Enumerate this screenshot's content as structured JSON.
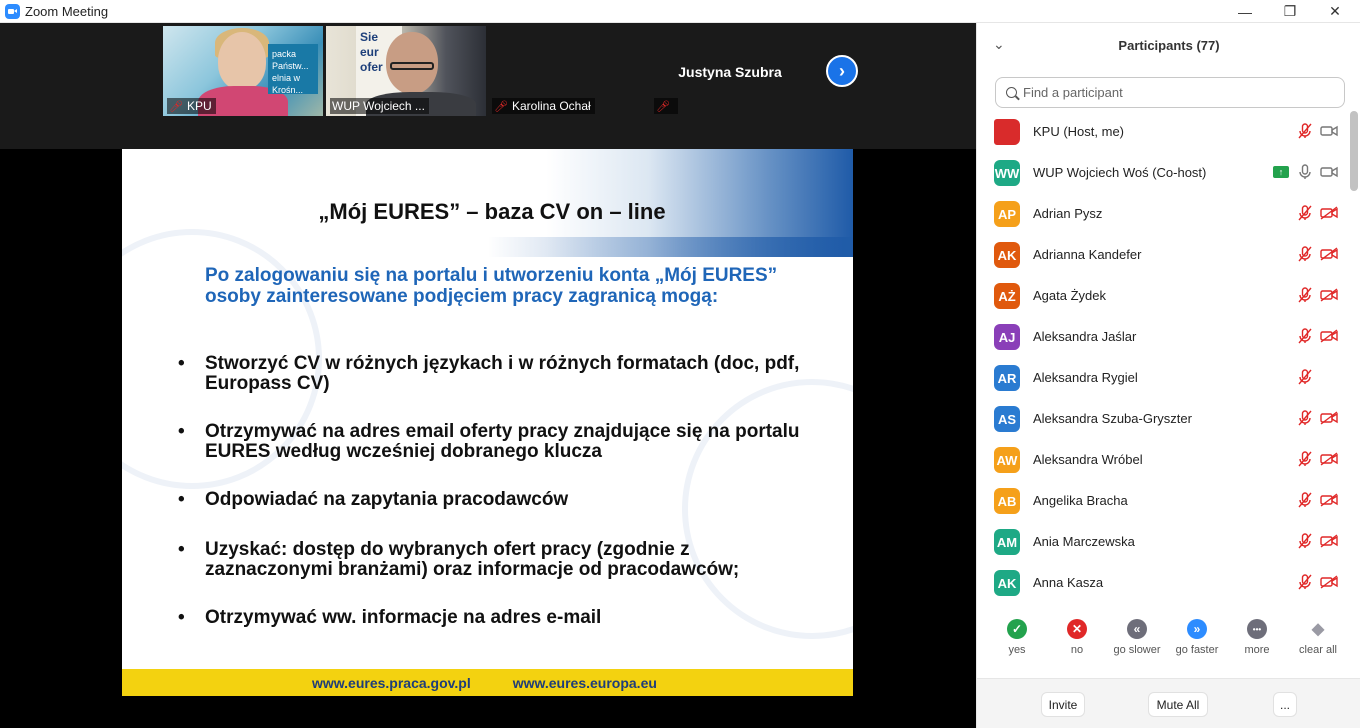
{
  "window": {
    "title": "Zoom Meeting"
  },
  "video_strip": {
    "tiles": [
      {
        "name": "KPU",
        "muted": true
      },
      {
        "name": "WUP Wojciech ...",
        "muted": false
      },
      {
        "name": "Karolina Ochał",
        "muted": true
      },
      {
        "name": "Justyna Szubra",
        "muted": true
      }
    ],
    "thumb1_sign": "packa Państw... elnia w Krośn...",
    "thumb2_sign": "Sie eur ofer"
  },
  "slide": {
    "title": "„Mój EURES” – baza CV on – line",
    "intro": "Po zalogowaniu się na portalu i utworzeniu konta „Mój EURES” osoby zainteresowane podjęciem pracy zagranicą mogą:",
    "bullet_symbol": "•",
    "bullets": [
      "Stworzyć CV w różnych językach i w różnych formatach (doc, pdf, Europass CV)",
      "Otrzymywać na adres email oferty pracy znajdujące się na portalu EURES według wcześniej dobranego klucza",
      "Odpowiadać na zapytania pracodawców",
      "Uzyskać: dostęp do wybranych ofert pracy (zgodnie z zaznaczonymi branżami) oraz informacje od pracodawców;",
      "Otrzymywać ww. informacje na adres e-mail"
    ],
    "footer_links": [
      "www.eures.praca.gov.pl",
      "www.eures.europa.eu"
    ]
  },
  "participants_panel": {
    "title": "Participants (77)",
    "search_placeholder": "Find a participant",
    "participants": [
      {
        "name": "KPU (Host, me)",
        "initials": "",
        "avatar_color": "#d92b2b",
        "mic": "muted",
        "cam": "on",
        "sharing": false
      },
      {
        "name": "WUP Wojciech Woś (Co-host)",
        "initials": "WW",
        "avatar_color": "#1ea985",
        "mic": "on",
        "cam": "on",
        "sharing": true
      },
      {
        "name": "Adrian Pysz",
        "initials": "AP",
        "avatar_color": "#f5a01a",
        "mic": "muted",
        "cam": "off",
        "sharing": false
      },
      {
        "name": "Adrianna Kandefer",
        "initials": "AK",
        "avatar_color": "#e0590d",
        "mic": "muted",
        "cam": "off",
        "sharing": false
      },
      {
        "name": "Agata Żydek",
        "initials": "AŻ",
        "avatar_color": "#e0590d",
        "mic": "muted",
        "cam": "off",
        "sharing": false
      },
      {
        "name": "Aleksandra Jaślar",
        "initials": "AJ",
        "avatar_color": "#8a3fb8",
        "mic": "muted",
        "cam": "off",
        "sharing": false
      },
      {
        "name": "Aleksandra Rygiel",
        "initials": "AR",
        "avatar_color": "#2a7bd1",
        "mic": "muted",
        "cam": "none",
        "sharing": false
      },
      {
        "name": "Aleksandra Szuba-Gryszter",
        "initials": "AS",
        "avatar_color": "#2a7bd1",
        "mic": "muted",
        "cam": "off",
        "sharing": false
      },
      {
        "name": "Aleksandra Wróbel",
        "initials": "AW",
        "avatar_color": "#f5a01a",
        "mic": "muted",
        "cam": "off",
        "sharing": false
      },
      {
        "name": "Angelika Bracha",
        "initials": "AB",
        "avatar_color": "#f5a01a",
        "mic": "muted",
        "cam": "off",
        "sharing": false
      },
      {
        "name": "Ania Marczewska",
        "initials": "AM",
        "avatar_color": "#1ea985",
        "mic": "muted",
        "cam": "off",
        "sharing": false
      },
      {
        "name": "Anna Kasza",
        "initials": "AK",
        "avatar_color": "#1ea985",
        "mic": "muted",
        "cam": "off",
        "sharing": false
      }
    ],
    "reactions": [
      {
        "label": "yes",
        "glyph": "✓",
        "color": "#23a24d"
      },
      {
        "label": "no",
        "glyph": "✕",
        "color": "#e02828"
      },
      {
        "label": "go slower",
        "glyph": "«",
        "color": "#6e6e7a"
      },
      {
        "label": "go faster",
        "glyph": "»",
        "color": "#2d8cff"
      },
      {
        "label": "more",
        "glyph": "•••",
        "color": "#6e6e7a"
      },
      {
        "label": "clear all",
        "glyph": "◆",
        "color": "#9a9aa4"
      }
    ],
    "footer_buttons": {
      "invite": "Invite",
      "mute_all": "Mute All",
      "more": "..."
    }
  },
  "icons": {
    "mic_muted": "mic-muted-icon",
    "mic_on": "mic-icon",
    "cam_on": "camera-icon",
    "cam_off": "camera-off-icon",
    "share": "screen-share-icon"
  },
  "colors": {
    "muted_red": "#e02828",
    "accent_blue": "#1a73e8",
    "slide_blue_text": "#1f66b8",
    "footer_yellow": "#f3d210"
  }
}
